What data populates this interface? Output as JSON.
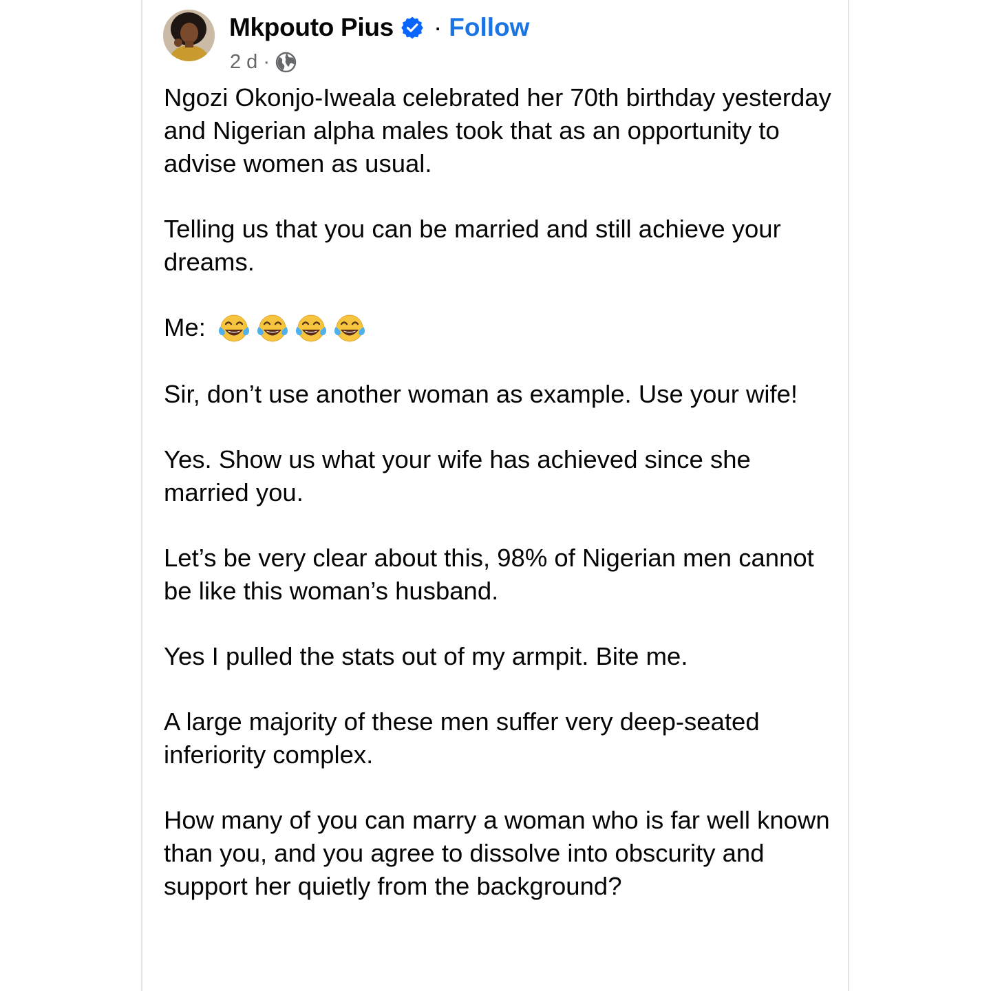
{
  "post": {
    "author": "Mkpouto Pius",
    "separator": "·",
    "follow_label": "Follow",
    "time": "2 d",
    "meta_separator": "·",
    "audience_icon": "globe-icon",
    "verified_icon": "verified-badge-icon",
    "paragraphs": {
      "p1": "Ngozi Okonjo-Iweala celebrated her 70th birthday yesterday and Nigerian alpha males took that as an opportunity to advise women as usual.",
      "p2": "Telling us that you can be married and still achieve your dreams.",
      "p3_prefix": "Me:",
      "p4": "Sir, don’t use another woman as example. Use your wife!",
      "p5": "Yes. Show us what your wife has achieved since she married you.",
      "p6": "Let’s be very clear about this, 98% of Nigerian men cannot be like this woman’s husband.",
      "p7": "Yes I pulled the stats out of my armpit. Bite me.",
      "p8": "A large majority of these men suffer very deep-seated inferiority complex.",
      "p9": "How many of you can marry a woman who is far well known than you, and you agree to dissolve into obscurity and support her quietly from the background?"
    },
    "emoji_icon": "face-with-tears-of-joy-icon",
    "emoji_count": 4
  },
  "colors": {
    "text": "#050505",
    "secondary_text": "#65676b",
    "link_blue": "#1b74e4",
    "verified_blue": "#0866ff",
    "border": "#e3e4e8"
  }
}
